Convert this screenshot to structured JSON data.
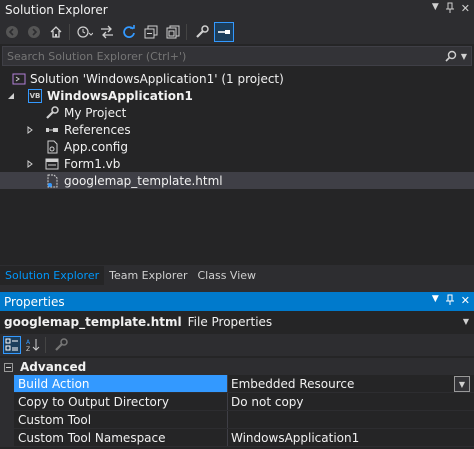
{
  "solution_explorer": {
    "title": "Solution Explorer",
    "title_buttons": [
      "▾",
      "📌",
      "✕"
    ],
    "search_placeholder": "Search Solution Explorer (Ctrl+')",
    "tree": {
      "solution": "Solution 'WindowsApplication1' (1 project)",
      "project": "WindowsApplication1",
      "project_icon_text": "VB",
      "items": [
        "My Project",
        "References",
        "App.config",
        "Form1.vb",
        "googlemap_template.html"
      ]
    },
    "tabs": [
      "Solution Explorer",
      "Team Explorer",
      "Class View"
    ]
  },
  "properties": {
    "title": "Properties",
    "object_name": "googlemap_template.html",
    "object_kind": "File Properties",
    "category": "Advanced",
    "rows": [
      {
        "name": "Build Action",
        "value": "Embedded Resource"
      },
      {
        "name": "Copy to Output Directory",
        "value": "Do not copy"
      },
      {
        "name": "Custom Tool",
        "value": ""
      },
      {
        "name": "Custom Tool Namespace",
        "value": "WindowsApplication1"
      }
    ]
  },
  "colors": {
    "accent": "#007acc",
    "selection": "#3399ff",
    "background": "#252526",
    "chrome": "#2d2d30"
  }
}
